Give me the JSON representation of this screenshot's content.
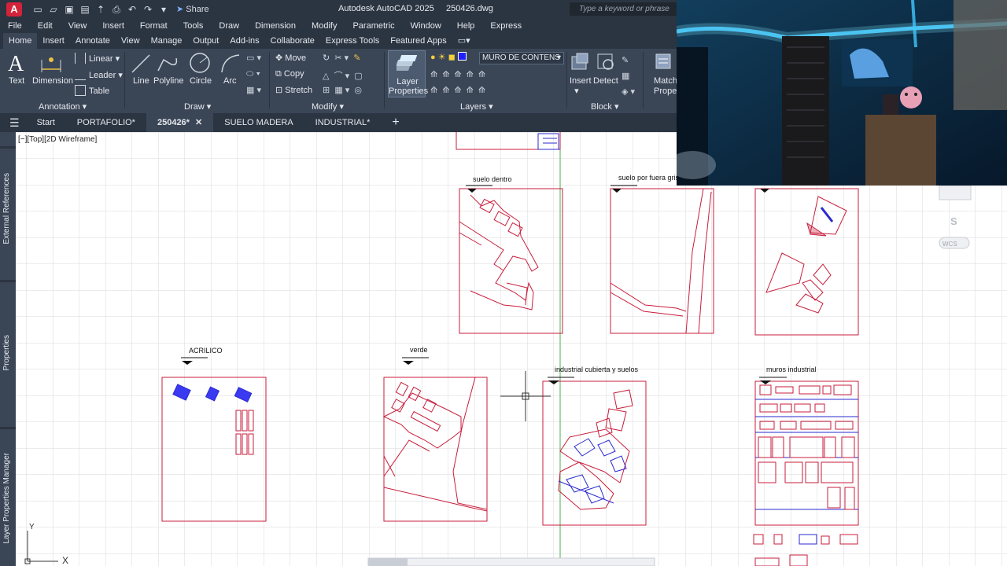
{
  "titlebar": {
    "app_title": "Autodesk AutoCAD 2025     250426.dwg",
    "app_logo": "A",
    "share_label": "Share",
    "search_placeholder": "Type a keyword or phrase"
  },
  "menu": [
    "File",
    "Edit",
    "View",
    "Insert",
    "Format",
    "Tools",
    "Draw",
    "Dimension",
    "Modify",
    "Parametric",
    "Window",
    "Help",
    "Express"
  ],
  "ribbon_tabs": [
    "Home",
    "Insert",
    "Annotate",
    "View",
    "Manage",
    "Output",
    "Add-ins",
    "Collaborate",
    "Express Tools",
    "Featured Apps"
  ],
  "ribbon": {
    "annotation": {
      "text": "Text",
      "dimension": "Dimension",
      "linear": "Linear",
      "leader": "Leader",
      "table": "Table",
      "panel": "Annotation"
    },
    "draw": {
      "line": "Line",
      "polyline": "Polyline",
      "circle": "Circle",
      "arc": "Arc",
      "panel": "Draw"
    },
    "modify": {
      "move": "Move",
      "copy": "Copy",
      "stretch": "Stretch",
      "panel": "Modify"
    },
    "layers": {
      "layer_properties_1": "Layer",
      "layer_properties_2": "Properties",
      "current_layer": "MURO DE CONTENS",
      "panel": "Layers"
    },
    "block": {
      "insert": "Insert",
      "detect": "Detect",
      "panel": "Block"
    },
    "properties": {
      "match_1": "Match",
      "match_2": "Propertie"
    }
  },
  "file_tabs": [
    "Start",
    "PORTAFOLIO*",
    "250426*",
    "SUELO MADERA",
    "INDUSTRIAL*"
  ],
  "active_file_tab": "250426*",
  "palettes": [
    "External References",
    "Properties",
    "Layer Properties Manager"
  ],
  "viewport_label": "[−][Top][2D Wireframe]",
  "sheets": {
    "s1": "suelo dentro",
    "s2": "suelo por fuera gris",
    "s3": "ACRILICO",
    "s4": "verde",
    "s5": "industrial cubierta y suelos",
    "s6": "muros industrial"
  },
  "viewcube": {
    "south": "S",
    "wcs": "WCS"
  },
  "ucs": {
    "y": "Y",
    "x": "X"
  },
  "colors": {
    "accent": "#3a4556",
    "dark": "#2b3441",
    "drawing_red": "#c81e3c",
    "drawing_blue": "#2a2ad0",
    "grid": "#d6d6d6"
  }
}
